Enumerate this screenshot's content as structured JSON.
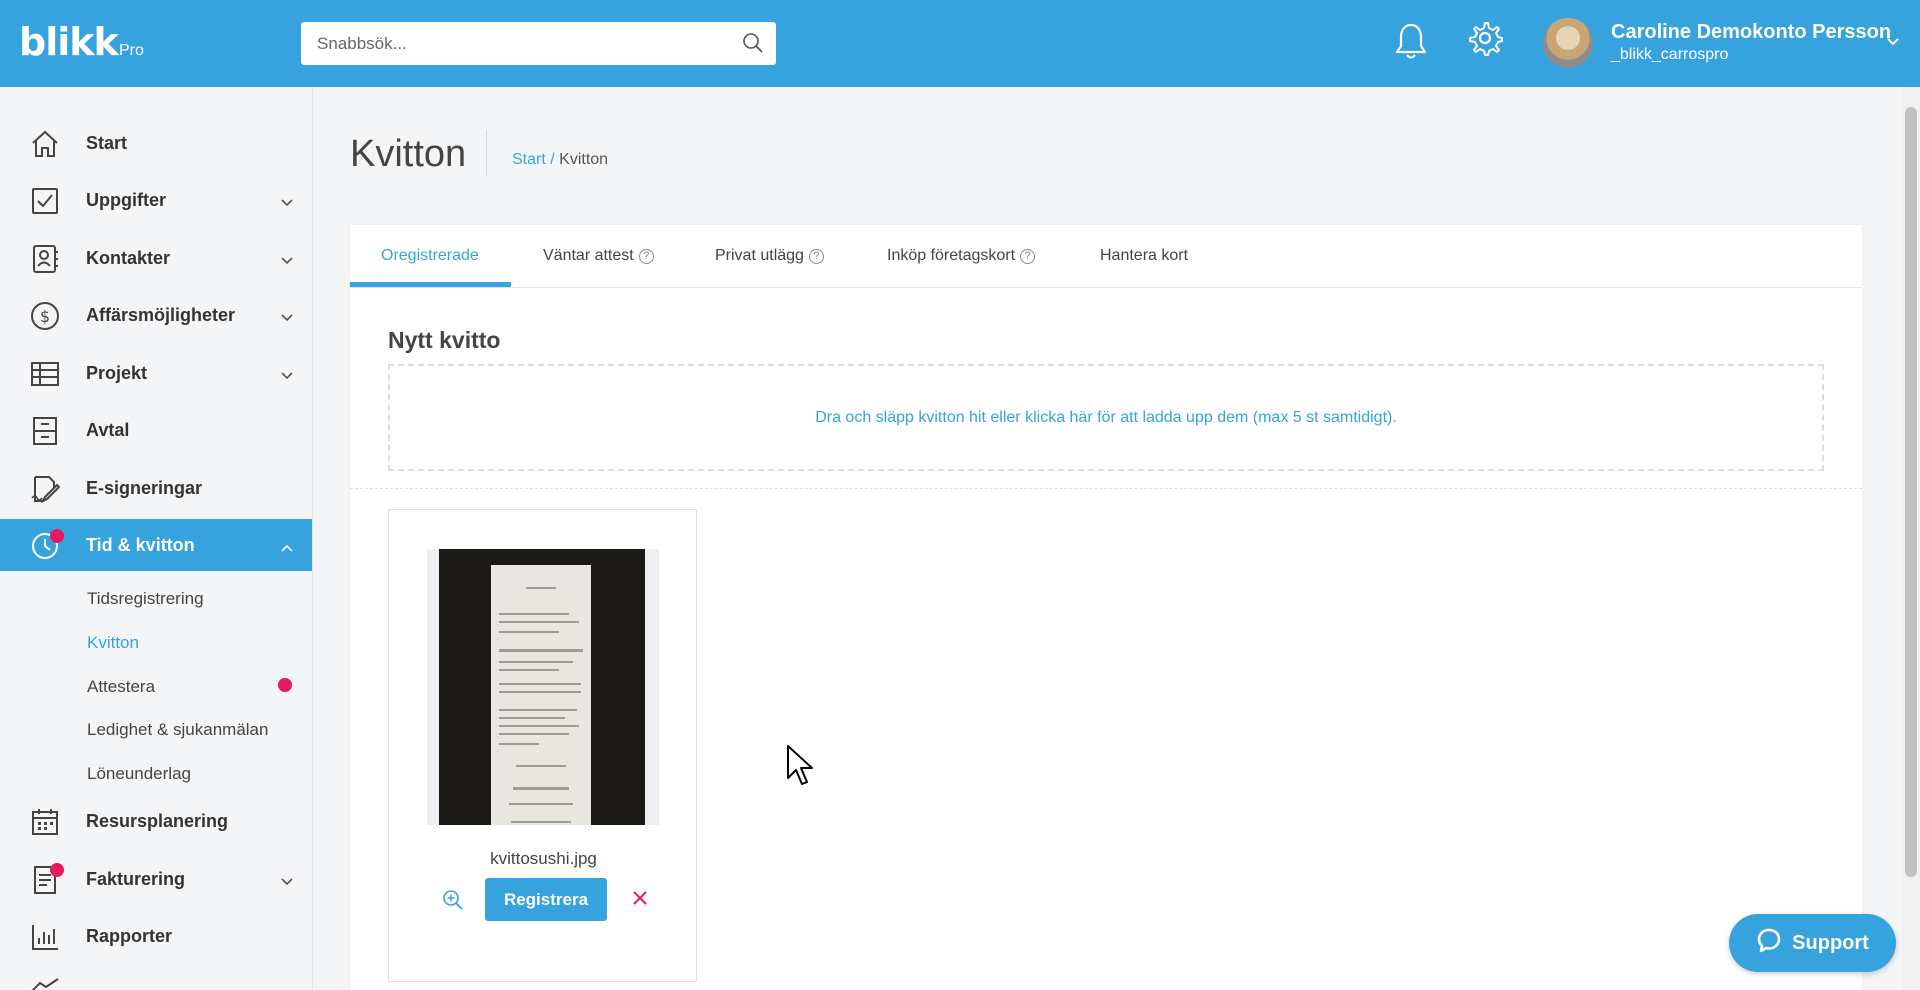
{
  "brand": {
    "logo": "blikk",
    "edition": "Pro"
  },
  "header": {
    "search_placeholder": "Snabbsök...",
    "user_name": "Caroline Demokonto Persson",
    "user_handle": "_blikk_carrospro"
  },
  "sidebar": {
    "items": [
      {
        "label": "Start",
        "icon": "home-icon"
      },
      {
        "label": "Uppgifter",
        "icon": "checkbox-icon"
      },
      {
        "label": "Kontakter",
        "icon": "contacts-icon"
      },
      {
        "label": "Affärsmöjligheter",
        "icon": "dollar-icon"
      },
      {
        "label": "Projekt",
        "icon": "table-icon"
      },
      {
        "label": "Avtal",
        "icon": "cabinet-icon"
      },
      {
        "label": "E-signeringar",
        "icon": "sign-icon"
      },
      {
        "label": "Tid & kvitton",
        "icon": "clock-icon"
      },
      {
        "label": "Resursplanering",
        "icon": "calendar-icon"
      },
      {
        "label": "Fakturering",
        "icon": "invoice-icon"
      },
      {
        "label": "Rapporter",
        "icon": "bar-chart-icon"
      }
    ],
    "sub_items": [
      "Tidsregistrering",
      "Kvitton",
      "Attestera",
      "Ledighet & sjukanmälan",
      "Löneunderlag"
    ],
    "accent": "#36a3de",
    "notification_color": "#e5195f"
  },
  "page": {
    "title": "Kvitton",
    "breadcrumb": {
      "home": "Start",
      "separator": "/",
      "current": "Kvitton"
    }
  },
  "tabs": [
    "Oregistrerade",
    "Väntar attest",
    "Privat utlägg",
    "Inköp företagskort",
    "Hantera kort"
  ],
  "new_receipt": {
    "title": "Nytt kvitto",
    "dropzone_text": "Dra och släpp kvitton hit eller klicka här för att ladda upp dem (max 5 st samtidigt)."
  },
  "receipt": {
    "filename": "kvittosushi.jpg",
    "register_label": "Registrera"
  },
  "support_label": "Support"
}
